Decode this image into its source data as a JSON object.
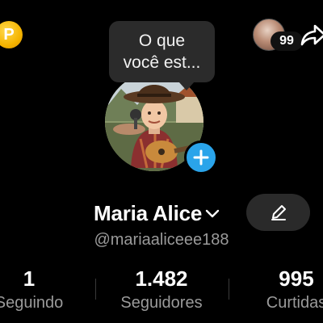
{
  "top_bar": {
    "coin_glyph": "P",
    "friends_count": "99"
  },
  "notes": {
    "line1": "O que",
    "line2": "você est..."
  },
  "profile": {
    "name": "Maria Alice",
    "handle": "@mariaaliceee188"
  },
  "stats": [
    {
      "value": "1",
      "label": "Seguindo"
    },
    {
      "value": "1.482",
      "label": "Seguidores"
    },
    {
      "value": "995",
      "label": "Curtidas"
    }
  ],
  "colors": {
    "background": "#000000",
    "add_button": "#2aa4ea",
    "coin": "#f5b400",
    "secondary_text": "#9a9a9a"
  },
  "icons": {
    "coin": "coin-icon",
    "share": "share-arrow-icon",
    "add": "plus-icon",
    "chevron": "chevron-down-icon",
    "edit": "pencil-icon"
  }
}
